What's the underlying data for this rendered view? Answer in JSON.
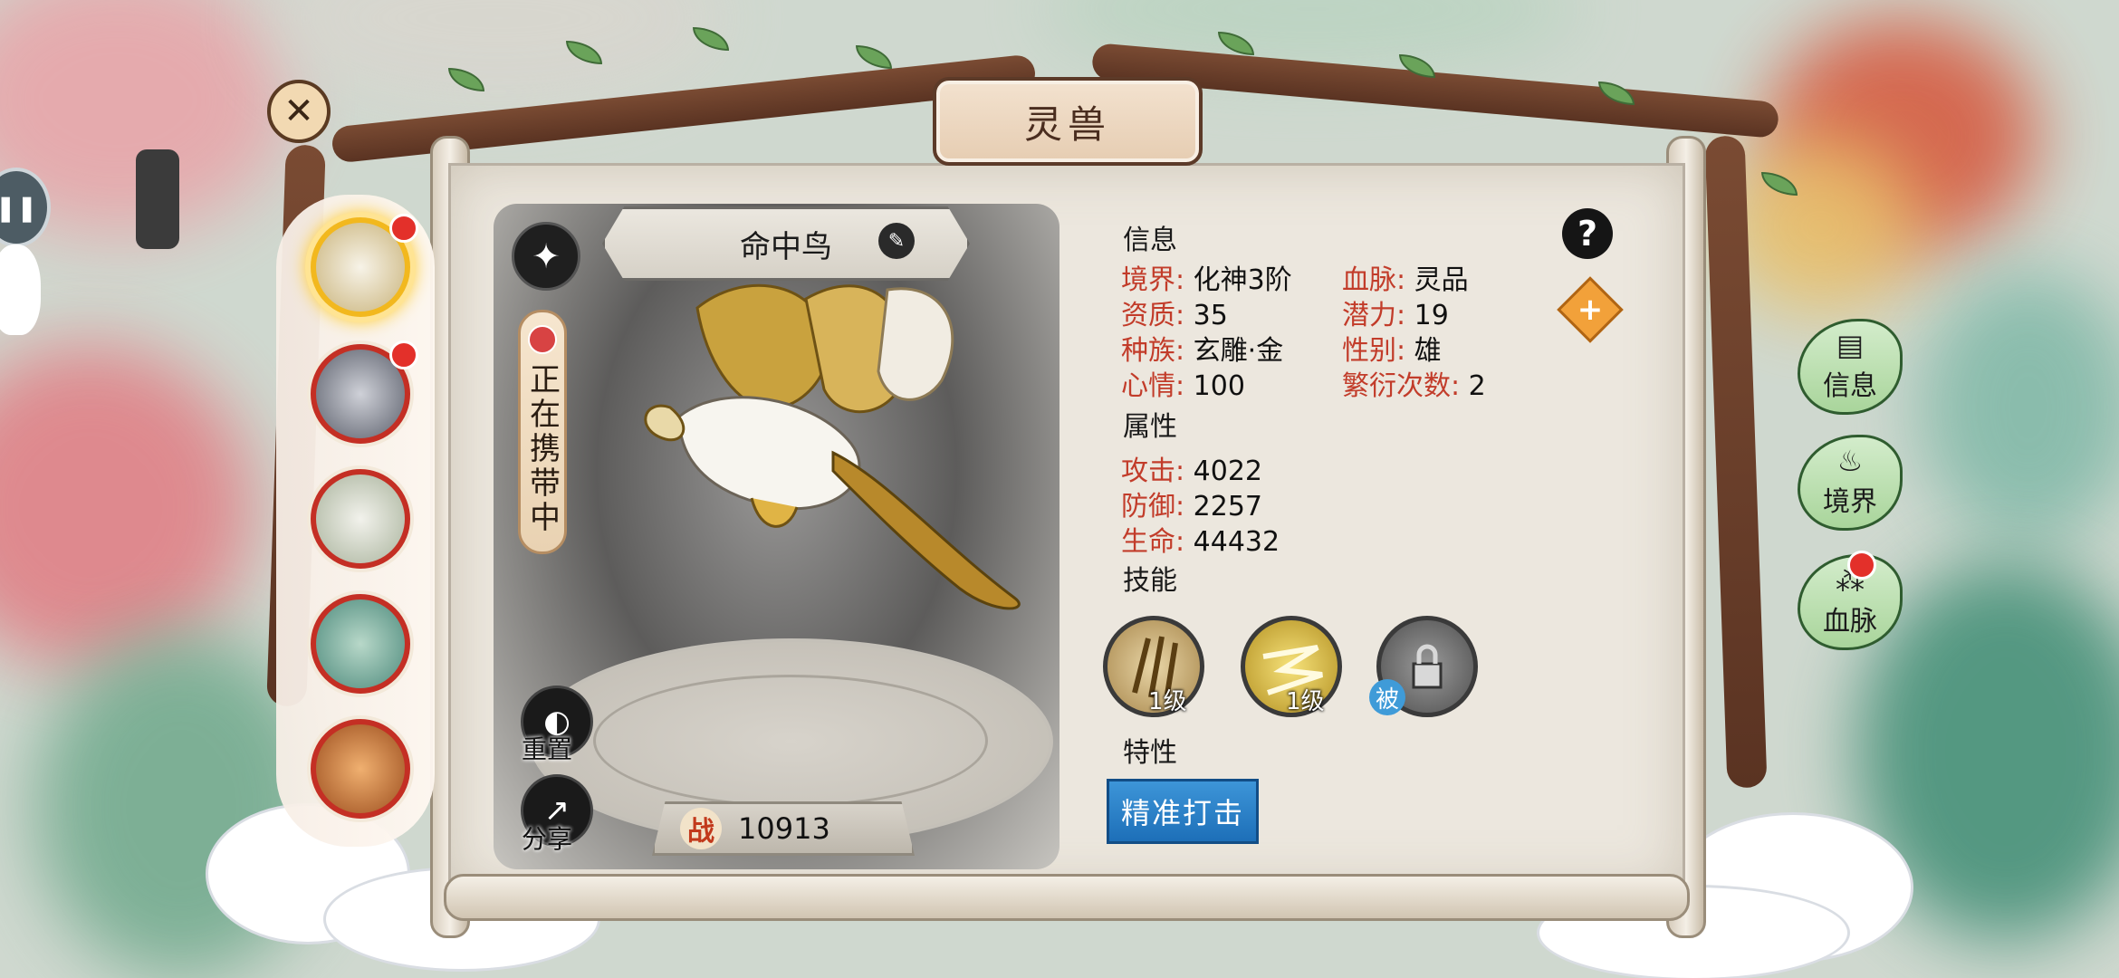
{
  "window": {
    "title": "灵兽"
  },
  "pet_list": {
    "items": [
      {
        "name": "pet-1",
        "selected": true,
        "red_dot": true
      },
      {
        "name": "pet-2",
        "selected": false,
        "red_dot": true
      },
      {
        "name": "pet-3",
        "selected": false,
        "red_dot": false
      },
      {
        "name": "pet-4",
        "selected": false,
        "red_dot": false
      },
      {
        "name": "pet-5",
        "selected": false,
        "red_dot": false
      }
    ]
  },
  "pet": {
    "name": "命中鸟",
    "carry_status": "正在携带中",
    "reset_label": "重置",
    "share_label": "分享",
    "power_icon": "战",
    "power": "10913"
  },
  "info": {
    "title": "信息",
    "realm_key": "境界:",
    "realm_val": "化神3阶",
    "blood_key": "血脉:",
    "blood_val": "灵品",
    "aptitude_key": "资质:",
    "aptitude_val": "35",
    "potential_key": "潜力:",
    "potential_val": "19",
    "race_key": "种族:",
    "race_val": "玄雕·金",
    "gender_key": "性别:",
    "gender_val": "雄",
    "mood_key": "心情:",
    "mood_val": "100",
    "breed_key": "繁衍次数:",
    "breed_val": "2"
  },
  "attributes": {
    "title": "属性",
    "atk_key": "攻击:",
    "atk_val": "4022",
    "def_key": "防御:",
    "def_val": "2257",
    "hp_key": "生命:",
    "hp_val": "44432"
  },
  "skills": {
    "title": "技能",
    "list": [
      {
        "level": "1级",
        "icon": "claw-skill-icon"
      },
      {
        "level": "1级",
        "icon": "lightning-skill-icon"
      },
      {
        "level": "被",
        "icon": "locked-skill-icon"
      }
    ]
  },
  "traits": {
    "title": "特性",
    "button": "精准打击"
  },
  "tabs": [
    {
      "label": "信息",
      "icon": "scroll-icon"
    },
    {
      "label": "境界",
      "icon": "flame-icon"
    },
    {
      "label": "血脉",
      "icon": "bloodline-icon",
      "red_dot": true
    }
  ],
  "colors": {
    "key_red": "#c23c2a",
    "selected_ring": "#f2b81e",
    "thumb_ring": "#c42f24",
    "trait_blue": "#1d6fb8"
  }
}
